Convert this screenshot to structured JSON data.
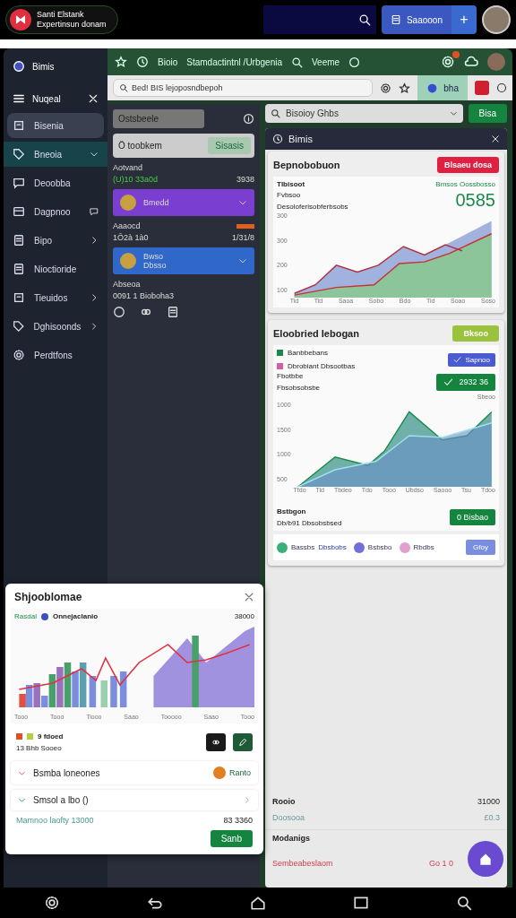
{
  "status_bar": {
    "app_name": "Santi Elstank",
    "app_subtitle": "Expertinsun donam",
    "action": "Saaooon",
    "add": "+"
  },
  "header": {
    "title": "Bimis",
    "links": [
      "Bioio",
      "Stamdactintnl /Urbgenia",
      "Veeme"
    ]
  },
  "sidebar": {
    "section": "Nuqeal",
    "items": [
      {
        "label": "Bisenia",
        "selected": false,
        "hovered": true,
        "kind": "plain"
      },
      {
        "label": "Bneoia",
        "selected": true,
        "hovered": false,
        "kind": "expandable"
      },
      {
        "label": "Deoobba",
        "selected": false,
        "hovered": false,
        "kind": "plain"
      },
      {
        "label": "Dagpnoo",
        "selected": false,
        "hovered": false,
        "kind": "message"
      },
      {
        "label": "Bipo",
        "selected": false,
        "hovered": false,
        "kind": "submenu"
      },
      {
        "label": "Nioctioride",
        "selected": false,
        "hovered": false,
        "kind": "plain"
      },
      {
        "label": "Tieuidos",
        "selected": false,
        "hovered": false,
        "kind": "submenu"
      },
      {
        "label": "Dghisoonds",
        "selected": false,
        "hovered": false,
        "kind": "submenu"
      },
      {
        "label": "Perdtfons",
        "selected": false,
        "hovered": false,
        "kind": "plain"
      }
    ]
  },
  "address_bar": {
    "value": "Bed! BIS lejoposndbepoh",
    "chip": "bha"
  },
  "middle": {
    "field": "Ostsbeele",
    "filter": {
      "label": "Ö toobkem",
      "badge": "Sisasis"
    },
    "blocks": [
      {
        "kind": "stat",
        "label": "Aotvand",
        "value": "(U)10 33a0d",
        "amount": "3938",
        "tag": false
      },
      {
        "kind": "dropdown",
        "title": "Bmedd",
        "color": "#7a3fd0"
      },
      {
        "kind": "stat",
        "label": "Aaaocd",
        "value": "1Ô2à 1à0",
        "amount": "1/31/8",
        "tag": true
      },
      {
        "kind": "dropdown",
        "title": "Bwso",
        "subtitle": "Dbsso",
        "color": "#2f68c8"
      },
      {
        "kind": "note",
        "label": "Abseoa",
        "value": "0091 1 Bioboha3"
      }
    ]
  },
  "right": {
    "select": "Bisoioy Ghbs",
    "select_button": "Bisa",
    "panel_title": "Bimis",
    "report": {
      "title": "Bepnobobuon",
      "button": "Blsaeu dosa",
      "chart_title": "Tlbisoot",
      "chart_subtitle": "Fvbsoo",
      "chart_caption": "Desoloferisobferbsobs",
      "kpi_label": "Bmsos Oossbosso",
      "kpi_value": "0585",
      "y_labels": [
        "300",
        "300",
        "200",
        "100"
      ],
      "x_labels": [
        "Tid",
        "Tid",
        "Saoa",
        "Sobo",
        "Bdo",
        "Tid",
        "Soao",
        "Soso"
      ]
    },
    "trend": {
      "title": "Eloobried Iebogan",
      "button": "Bksoo",
      "legend": [
        {
          "label": "Banbbebans",
          "color": "#1a8a4a"
        },
        {
          "label": "Dbrobiant Dbsootbas",
          "color": "#d060a0"
        }
      ],
      "confirm": "Sapnoo",
      "label": "Fbotbbe",
      "caption": "Fbsobsobsbe",
      "value": "2932 36",
      "corner": "Sbeoo",
      "y_labels": [
        "1000",
        "1500",
        "1000",
        "500"
      ],
      "x_labels": [
        "Tfdo",
        "Tid",
        "Tbdeo",
        "Tdo",
        "Tooo",
        "Ubdso",
        "Saooo",
        "Tsu",
        "Tdoo"
      ],
      "footer_title": "Bstbgon",
      "footer_text": "Db/b91 Dbsobsbsed",
      "footer_button": "0 Bisbao",
      "chips": [
        {
          "label": "Bassbs",
          "extra": "Dbsbobs",
          "color": "#3bb07a"
        },
        {
          "label": "Bsbsbo",
          "color": "#7070d8"
        },
        {
          "label": "Rbdbs",
          "color": "#e0a0d0"
        }
      ],
      "chip_button": "Gfoy"
    },
    "summary": [
      {
        "kind": "plain",
        "label": "Rooio",
        "value": "31000"
      },
      {
        "kind": "muted",
        "label": "Doosooa",
        "value": "£0.3"
      },
      {
        "kind": "heading",
        "label": "Modanigs"
      },
      {
        "kind": "alert",
        "label": "Sembeabeslaom",
        "value": "Go 1 0"
      }
    ]
  },
  "modal": {
    "title": "Shjooblomae",
    "legend_label": "Rasdal",
    "series_label": "Onnejaclanio",
    "corner": "38000",
    "x_labels": [
      "Tooo",
      "Tooo",
      "Tiooo",
      "Saao",
      "Tooooo",
      "Saao",
      "Tooo"
    ],
    "key_label": "9 fdoed",
    "key_text": "13 Bhb Sooeo",
    "rows": [
      {
        "kind": "alert",
        "label": "Bsmba loneones",
        "badge": "Ranto"
      },
      {
        "kind": "expand",
        "label": "Smsol a lbo ()"
      }
    ],
    "detail": "Mamnoo laofty 13000",
    "amount": "83 3360",
    "button": "Sanb"
  }
}
